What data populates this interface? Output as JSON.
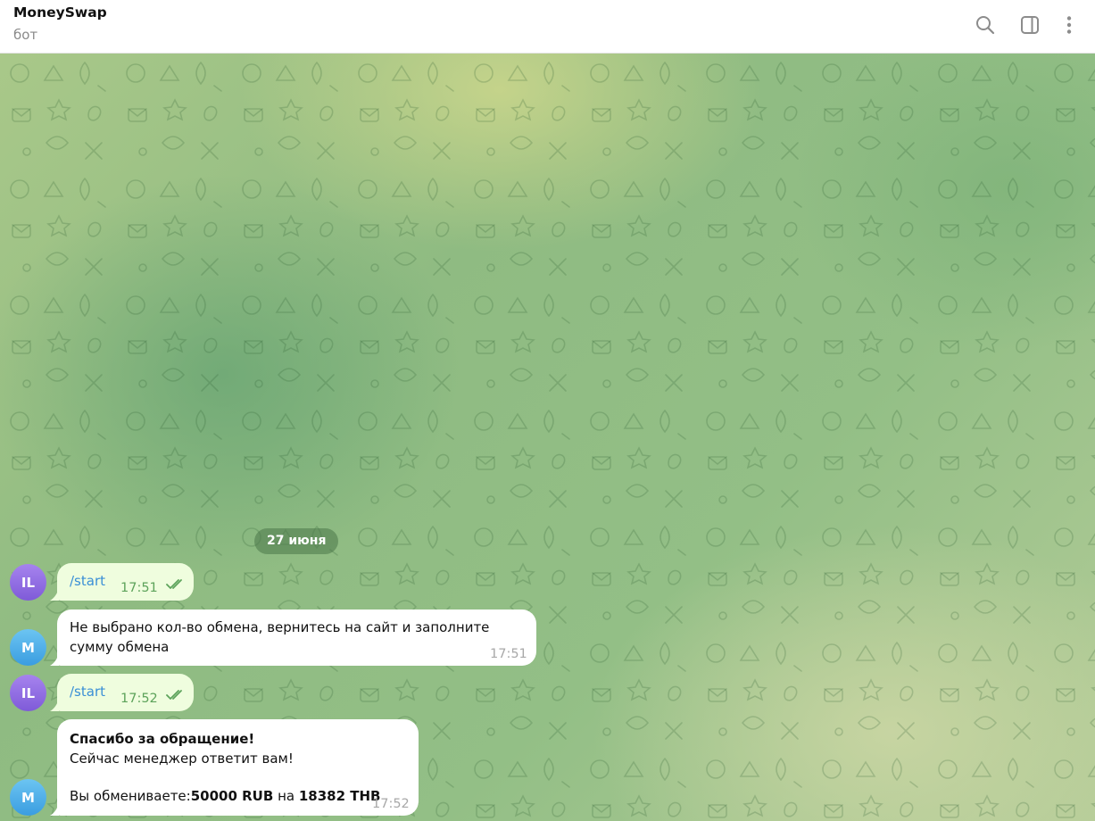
{
  "header": {
    "title": "MoneySwap",
    "subtitle": "бот",
    "icons": [
      "search-icon",
      "sidebar-toggle-icon",
      "more-vertical-icon"
    ]
  },
  "chat": {
    "date_label": "27 июня",
    "messages": [
      {
        "author": "IL",
        "direction": "out",
        "text": "/start",
        "time": "17:51",
        "status": "read"
      },
      {
        "author": "M",
        "direction": "in",
        "text_line1": "Не выбрано кол-во обмена, вернитесь на сайт и заполните",
        "text_line2": "сумму обмена",
        "time": "17:51"
      },
      {
        "author": "IL",
        "direction": "out",
        "text": "/start",
        "time": "17:52",
        "status": "read"
      },
      {
        "author": "M",
        "direction": "in",
        "heading": "Спасибо за обращение!",
        "line2": "Сейчас менеджер ответит вам!",
        "line4_prefix": "Вы обмениваете:",
        "amount_from": "50000 RUB",
        "connector": " на ",
        "amount_to": "18382 THB",
        "time": "17:52"
      }
    ]
  },
  "colors": {
    "outgoing_bubble": "#effdde",
    "incoming_bubble": "#ffffff",
    "command_link": "#3a8fd6",
    "outgoing_time": "#5da35b",
    "avatar_il": "#8e6be3",
    "avatar_m": "#4aaee8"
  }
}
